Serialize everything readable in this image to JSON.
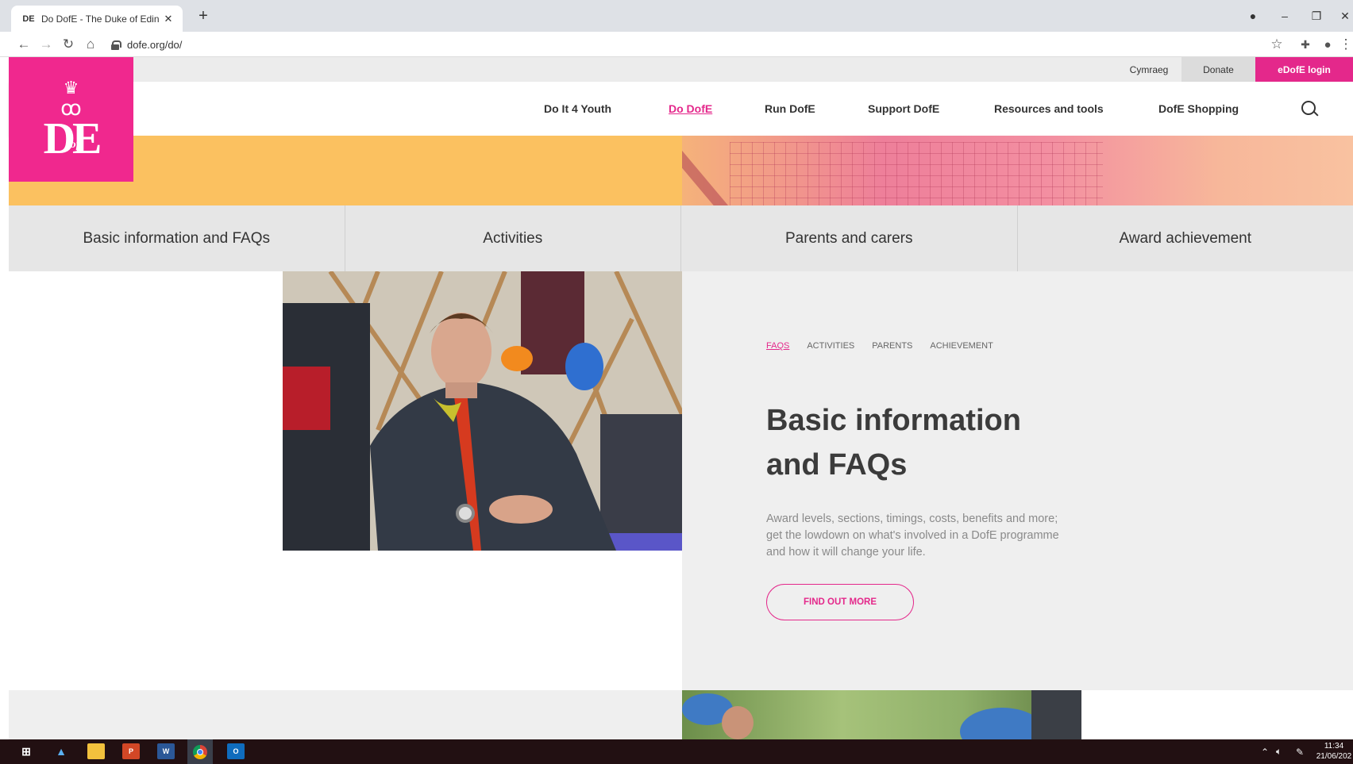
{
  "browser": {
    "tab_title": "Do DofE - The Duke of Edinburgh",
    "tab_favicon": "DE",
    "new_tab": "+",
    "url": "dofe.org/do/"
  },
  "header": {
    "util_links": [
      "Cymraeg",
      "Donate",
      "eDofE login"
    ],
    "logo_text": "DE",
    "logo_of": "of",
    "nav": [
      "Do It 4 Youth",
      "Do DofE",
      "Run DofE",
      "Support DofE",
      "Resources and tools",
      "DofE Shopping"
    ],
    "active_nav": "Do DofE"
  },
  "section_tabs": [
    "Basic information and FAQs",
    "Activities",
    "Parents and carers",
    "Award achievement"
  ],
  "content": {
    "subnav": [
      "FAQS",
      "ACTIVITIES",
      "PARENTS",
      "ACHIEVEMENT"
    ],
    "heading_line1": "Basic information",
    "heading_line2": "and FAQs",
    "description": "Award levels, sections, timings, costs, benefits and more; get the lowdown on what's involved in a DofE programme and how it will change your life.",
    "cta": "FIND OUT MORE"
  },
  "taskbar": {
    "time": "11:34",
    "date": "21/06/202"
  },
  "colors": {
    "brand_pink": "#e4288b",
    "logo_pink": "#f0288e",
    "hero_yellow": "#fbc160"
  },
  "icons": [
    "back-icon",
    "forward-icon",
    "reload-icon",
    "home-icon",
    "lock-icon",
    "star-icon",
    "extensions-icon",
    "profile-icon",
    "search-icon",
    "windows-start-icon",
    "file-explorer-icon",
    "powerpoint-icon",
    "word-icon",
    "chrome-icon",
    "outlook-icon"
  ]
}
